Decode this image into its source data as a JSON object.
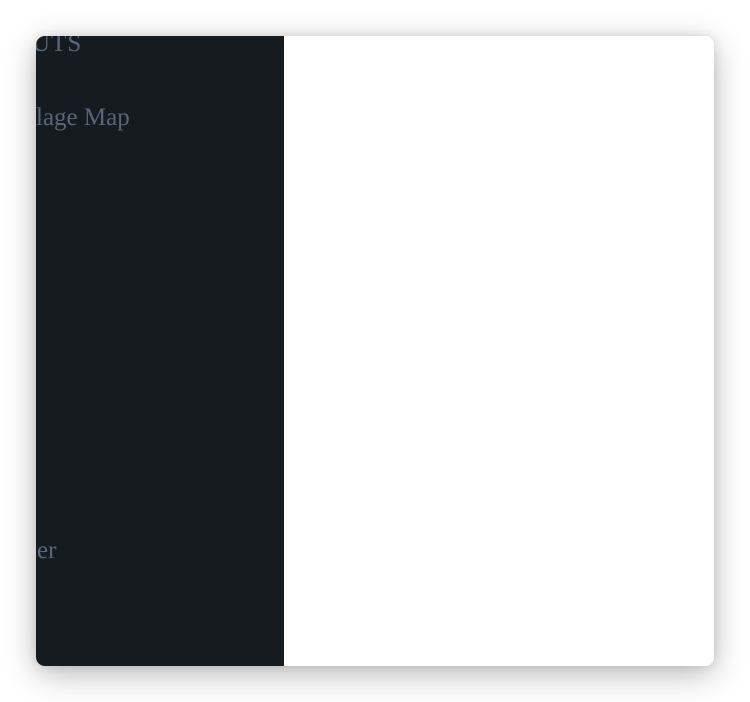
{
  "sidebar": {
    "section_heading": "UTS",
    "items": [
      {
        "label": "lage Map"
      },
      {
        "label": "er"
      }
    ]
  },
  "colors": {
    "sidebar_background": "#161b20",
    "sidebar_text": "#56677a",
    "content_background": "#ffffff"
  }
}
